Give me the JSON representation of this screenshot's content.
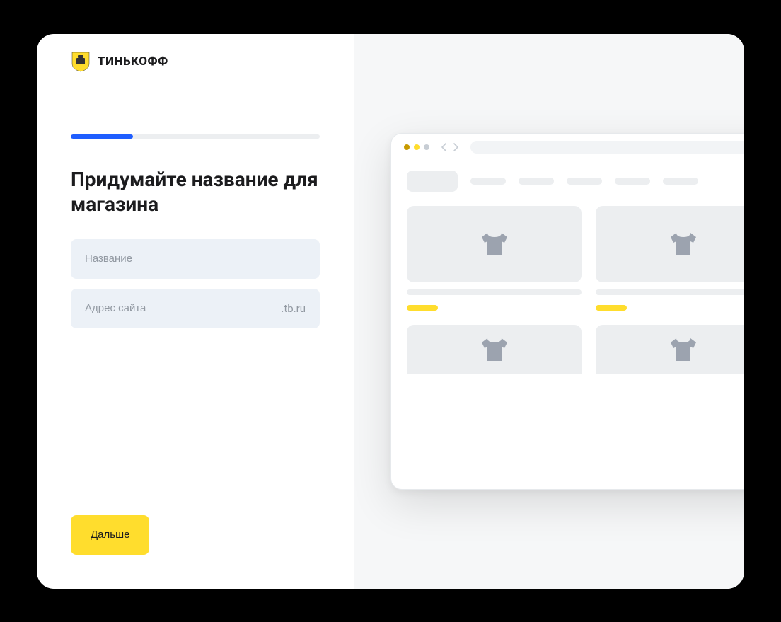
{
  "brand": "ТИНЬКОФФ",
  "progress": {
    "percent": 25
  },
  "heading": "Придумайте название для магазина",
  "fields": {
    "name_placeholder": "Название",
    "url_placeholder": "Адрес сайта",
    "url_suffix": ".tb.ru"
  },
  "actions": {
    "next_label": "Дальше"
  }
}
